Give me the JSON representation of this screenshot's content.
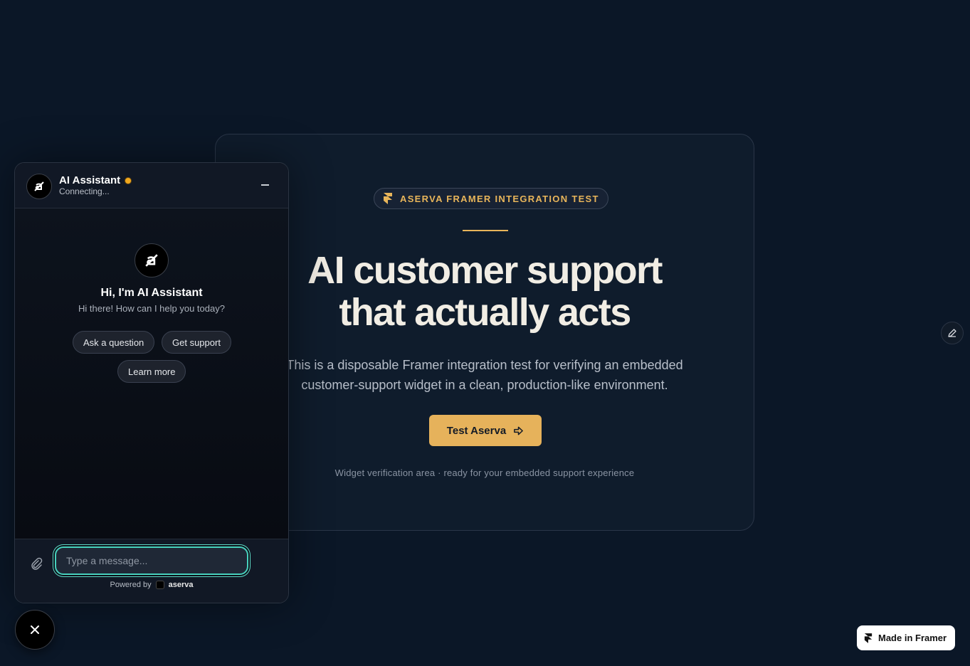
{
  "hero": {
    "badge_icon": "framer-icon",
    "badge_text": "ASERVA FRAMER INTEGRATION TEST",
    "headline_line1": "AI customer support",
    "headline_line2": "that actually acts",
    "subtext_line1": "This is a disposable Framer integration test for verifying an embedded",
    "subtext_line2": "customer-support widget in a clean, production-like environment.",
    "cta_label": "Test Aserva",
    "cta_icon": "arrow-right-icon",
    "footnote": "Widget verification area · ready for your embedded support experience",
    "accent_color": "#e6b25b"
  },
  "edit_button": {
    "icon": "pencil-icon"
  },
  "chat": {
    "title": "AI Assistant",
    "status": "Connecting...",
    "status_color": "#f0a81e",
    "welcome_title": "Hi, I'm AI Assistant",
    "welcome_subtitle": "Hi there! How can I help you today?",
    "quick_replies": [
      "Ask a question",
      "Get support",
      "Learn more"
    ],
    "input_placeholder": "Type a message...",
    "input_value": "",
    "powered_by_label": "Powered by",
    "powered_by_brand": "aserva",
    "input_focus_color": "#47d1bd"
  },
  "launcher": {
    "icon": "close-icon"
  },
  "framer_badge": {
    "label": "Made in Framer",
    "icon": "framer-icon"
  }
}
